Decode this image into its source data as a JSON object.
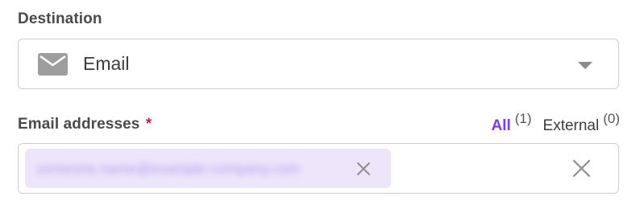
{
  "destination": {
    "label": "Destination",
    "icon": "mail-icon",
    "selected": "Email"
  },
  "email_addresses": {
    "label": "Email addresses",
    "required_marker": "*",
    "filters": [
      {
        "label": "All",
        "count": "(1)"
      },
      {
        "label": "External",
        "count": "(0)"
      }
    ],
    "chips": [
      {
        "value": "someone.name@example-company.com"
      }
    ]
  },
  "colors": {
    "accent": "#7c3aed",
    "chip_bg": "#ede6fb",
    "required": "#c21f43",
    "border": "#cfcfcf"
  }
}
